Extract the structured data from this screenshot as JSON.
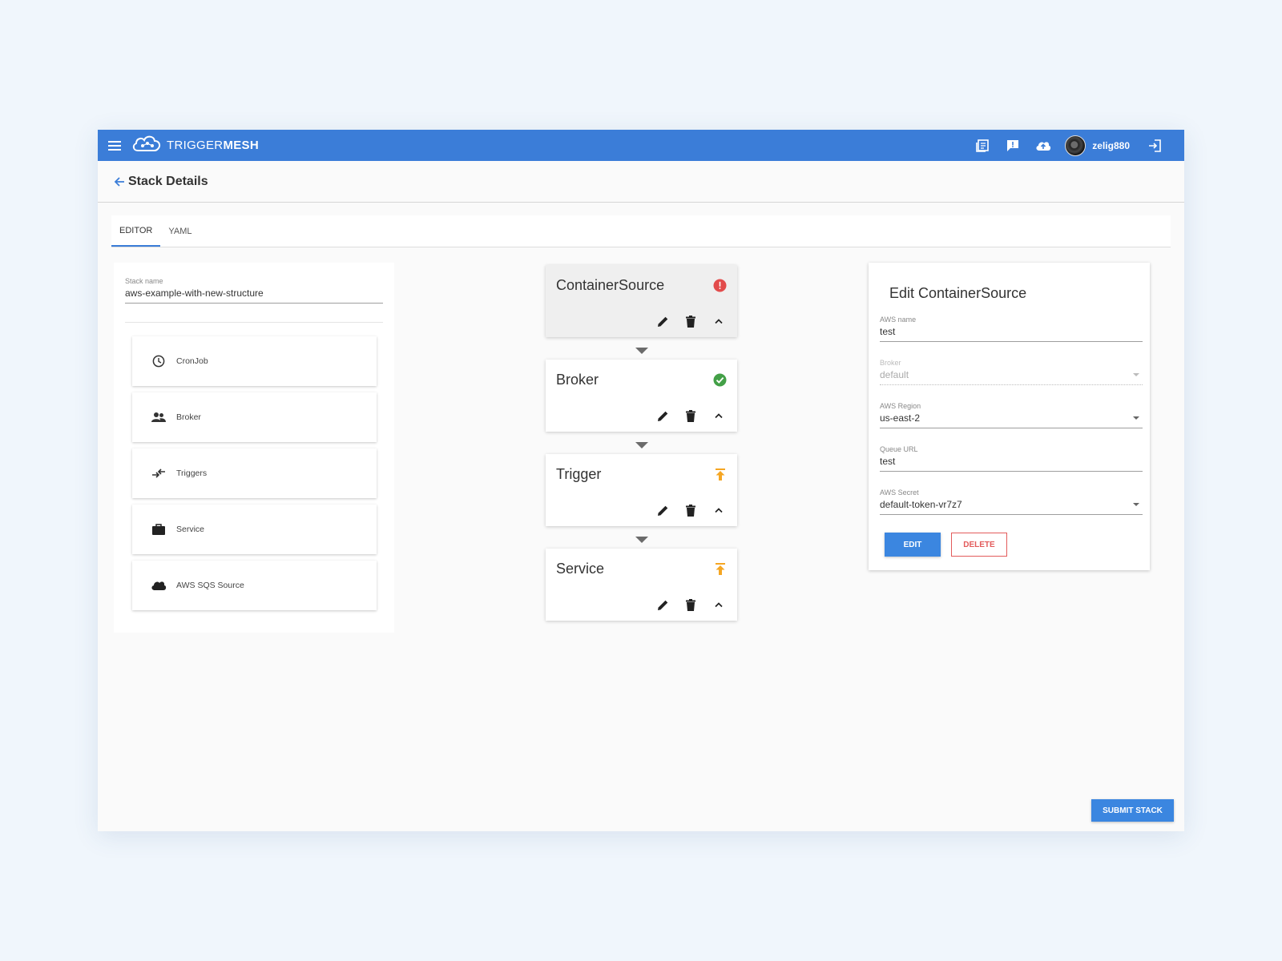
{
  "appbar": {
    "brand_light": "TRIGGER",
    "brand_bold": "MESH",
    "icons": [
      "menu-icon",
      "docs-icon",
      "feedback-icon",
      "cloud-upload-icon",
      "avatar",
      "logout-icon"
    ],
    "username": "zelig880"
  },
  "page": {
    "title": "Stack Details"
  },
  "tabs": [
    {
      "label": "EDITOR",
      "active": true
    },
    {
      "label": "YAML",
      "active": false
    }
  ],
  "left": {
    "stack_name_label": "Stack name",
    "stack_name_value": "aws-example-with-new-structure",
    "components": [
      {
        "label": "CronJob",
        "icon": "clock-icon"
      },
      {
        "label": "Broker",
        "icon": "people-icon"
      },
      {
        "label": "Triggers",
        "icon": "swap-icon"
      },
      {
        "label": "Service",
        "icon": "briefcase-icon"
      },
      {
        "label": "AWS SQS Source",
        "icon": "cloud-icon"
      }
    ]
  },
  "flow": [
    {
      "title": "ContainerSource",
      "status": "error",
      "status_color": "#e24b4b"
    },
    {
      "title": "Broker",
      "status": "ok",
      "status_color": "#43a047"
    },
    {
      "title": "Trigger",
      "status": "pending",
      "status_color": "#f5a623"
    },
    {
      "title": "Service",
      "status": "pending",
      "status_color": "#f5a623"
    }
  ],
  "edit": {
    "title": "Edit ContainerSource",
    "fields": [
      {
        "label": "AWS name",
        "value": "test",
        "type": "text",
        "disabled": false
      },
      {
        "label": "Broker",
        "value": "default",
        "type": "select",
        "disabled": true
      },
      {
        "label": "AWS Region",
        "value": "us-east-2",
        "type": "select",
        "disabled": false
      },
      {
        "label": "Queue URL",
        "value": "test",
        "type": "text",
        "disabled": false
      },
      {
        "label": "AWS Secret",
        "value": "default-token-vr7z7",
        "type": "select",
        "disabled": false
      }
    ],
    "edit_label": "EDIT",
    "delete_label": "DELETE"
  },
  "submit_label": "SUBMIT STACK",
  "colors": {
    "primary": "#3b7dd8",
    "button": "#3b86e0",
    "danger": "#e35b5b"
  }
}
